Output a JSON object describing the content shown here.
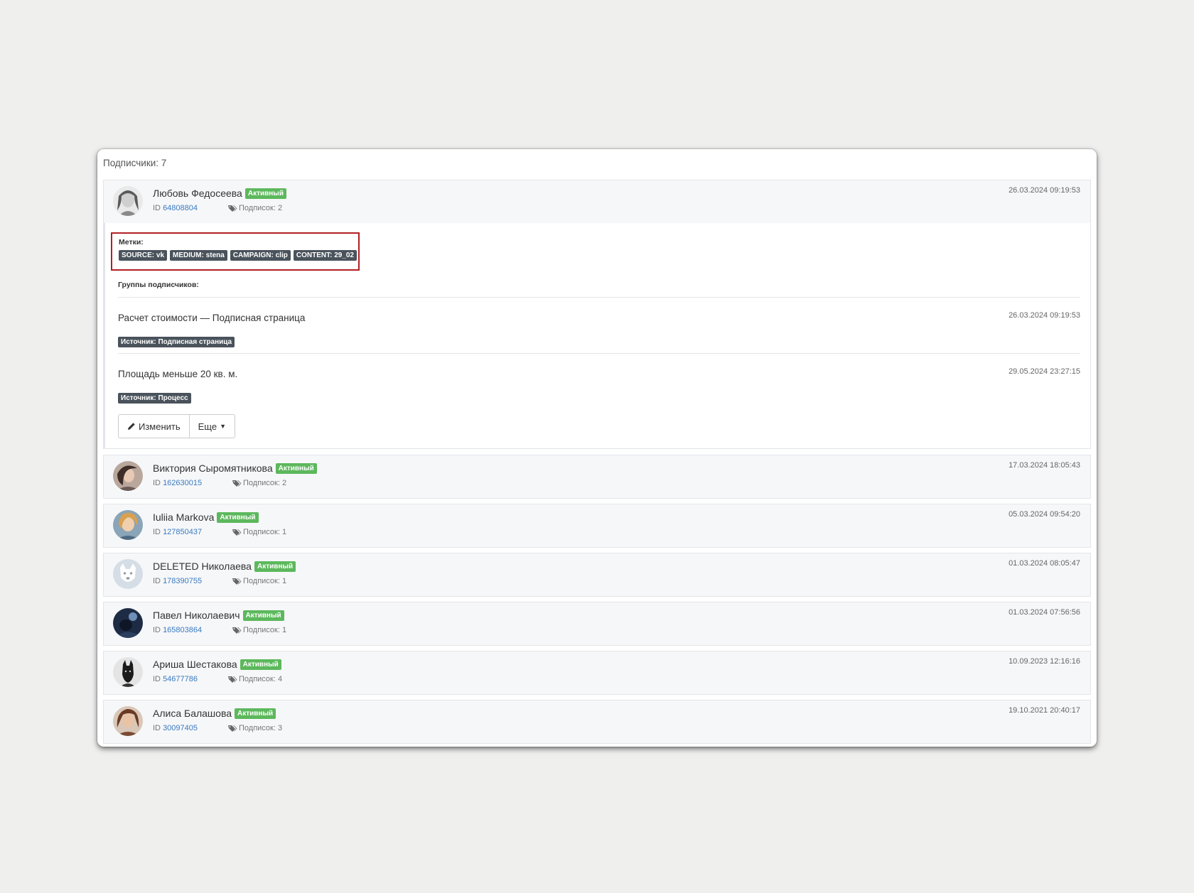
{
  "panel": {
    "heading": "Подписчики: 7"
  },
  "colors": {
    "active_badge": "#5cb85c",
    "dark_label": "#4a535c",
    "highlight_border": "#b21f24",
    "id_link": "#3a7bbf"
  },
  "subscribers": [
    {
      "name": "Любовь Федосеева",
      "status": "Активный",
      "id_prefix": "ID",
      "id": "64808804",
      "subs": "Подписок: 2",
      "date": "26.03.2024 09:19:53",
      "avatar_icon": "avatar-photo"
    },
    {
      "name": "Виктория Сыромятникова",
      "status": "Активный",
      "id_prefix": "ID",
      "id": "162630015",
      "subs": "Подписок: 2",
      "date": "17.03.2024 18:05:43",
      "avatar_icon": "avatar-photo"
    },
    {
      "name": "Iuliia Markova",
      "status": "Активный",
      "id_prefix": "ID",
      "id": "127850437",
      "subs": "Подписок: 1",
      "date": "05.03.2024 09:54:20",
      "avatar_icon": "avatar-photo"
    },
    {
      "name": "DELETED Николаева",
      "status": "Активный",
      "id_prefix": "ID",
      "id": "178390755",
      "subs": "Подписок: 1",
      "date": "01.03.2024 08:05:47",
      "avatar_icon": "deleted-dog-icon"
    },
    {
      "name": "Павел Николаевич",
      "status": "Активный",
      "id_prefix": "ID",
      "id": "165803864",
      "subs": "Подписок: 1",
      "date": "01.03.2024 07:56:56",
      "avatar_icon": "avatar-photo"
    },
    {
      "name": "Ариша Шестакова",
      "status": "Активный",
      "id_prefix": "ID",
      "id": "54677786",
      "subs": "Подписок: 4",
      "date": "10.09.2023 12:16:16",
      "avatar_icon": "avatar-photo"
    },
    {
      "name": "Алиса Балашова",
      "status": "Активный",
      "id_prefix": "ID",
      "id": "30097405",
      "subs": "Подписок: 3",
      "date": "19.10.2021 20:40:17",
      "avatar_icon": "avatar-photo"
    }
  ],
  "detail": {
    "labels_title": "Метки:",
    "labels": [
      "SOURCE: vk",
      "MEDIUM: stena",
      "CAMPAIGN: clip",
      "CONTENT: 29_02"
    ],
    "groups_title": "Группы подписчиков:",
    "groups": [
      {
        "name": "Расчет стоимости — Подписная страница",
        "date": "26.03.2024 09:19:53",
        "source": "Источник: Подписная страница"
      },
      {
        "name": "Площадь меньше 20 кв. м.",
        "date": "29.05.2024 23:27:15",
        "source": "Источник: Процесс"
      }
    ],
    "edit_button": "Изменить",
    "more_button": "Еще"
  }
}
